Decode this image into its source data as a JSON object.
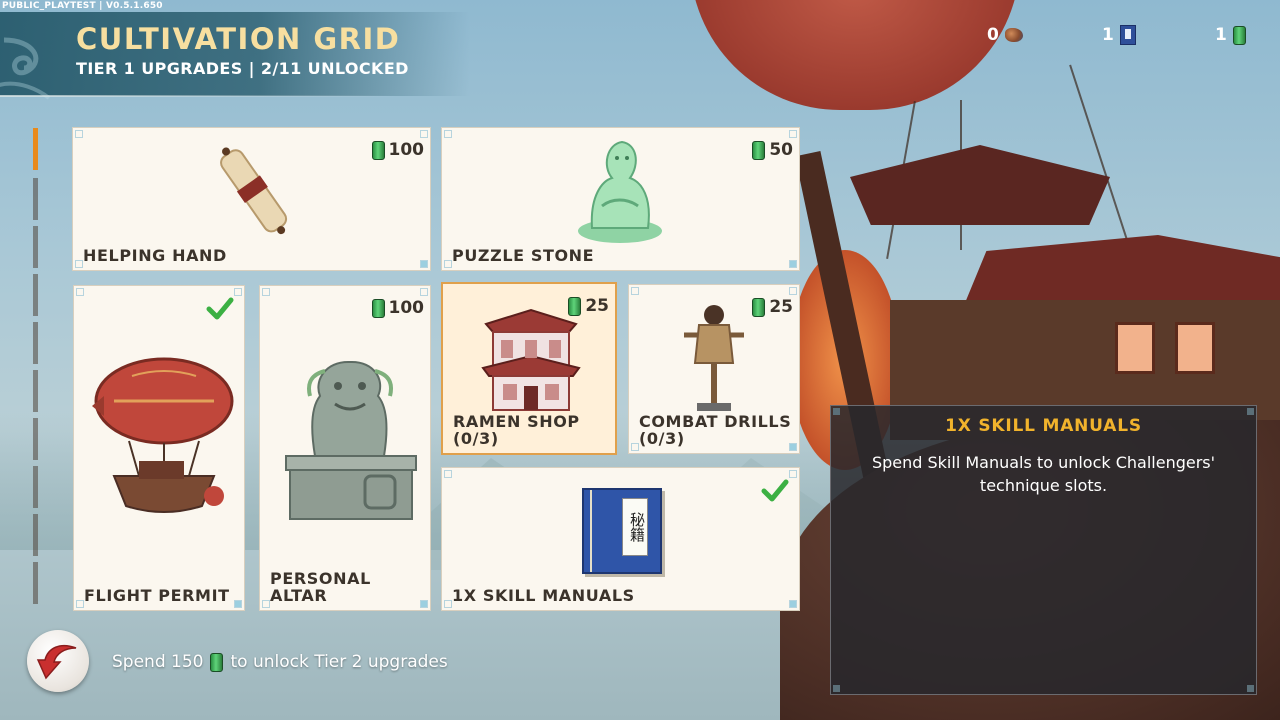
{
  "version": "PUBLIC_PLAYTEST | V0.5.1.650",
  "header": {
    "title": "CULTIVATION GRID",
    "subtitle": "TIER 1 UPGRADES | 2/11 UNLOCKED"
  },
  "currencies": [
    {
      "name": "ore",
      "value": "0",
      "icon": "ore-icon"
    },
    {
      "name": "skill-manual",
      "value": "1",
      "icon": "book-icon"
    },
    {
      "name": "jade",
      "value": "1",
      "icon": "gem-icon"
    }
  ],
  "rail": {
    "total": 10,
    "active_index": 0
  },
  "cards": {
    "helping_hand": {
      "label": "HELPING HAND",
      "cost": "100",
      "unlocked": false
    },
    "puzzle_stone": {
      "label": "PUZZLE STONE",
      "cost": "50",
      "unlocked": false
    },
    "flight_permit": {
      "label": "FLIGHT PERMIT",
      "unlocked": true
    },
    "personal_altar": {
      "label": "PERSONAL ALTAR",
      "cost": "100",
      "unlocked": false
    },
    "ramen_shop": {
      "label": "RAMEN SHOP (0/3)",
      "cost": "25",
      "selected": true
    },
    "combat_drills": {
      "label_line1": "COMBAT DRILLS",
      "label_line2": "(0/3)",
      "cost": "25"
    },
    "skill_manuals": {
      "label": "1X SKILL MANUALS",
      "unlocked": true,
      "book_text": "秘籍"
    }
  },
  "footer": {
    "tier_msg_before": "Spend 150",
    "tier_msg_after": "to unlock Tier 2 upgrades"
  },
  "detail": {
    "title": "1X SKILL MANUALS",
    "description": "Spend Skill Manuals to unlock Challengers' technique slots."
  },
  "colors": {
    "title": "#f7dfa0",
    "rail_active": "#e98a1b",
    "check": "#3cb043",
    "detail_title": "#f1b32c"
  }
}
